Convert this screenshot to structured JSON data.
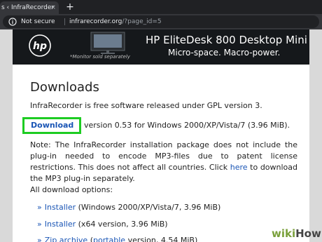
{
  "browser": {
    "tab_title": "s ‹ InfraRecorder",
    "tab_close": "×",
    "new_tab": "+",
    "not_secure": "Not secure",
    "url_domain": "infrarecorder.org",
    "url_path": "/?page_id=5"
  },
  "ad": {
    "title": "HP EliteDesk 800 Desktop Mini PC",
    "subtitle": "Micro-space. Macro-power.",
    "note": "*Monitor sold separately",
    "brand_color": "#15181b"
  },
  "page": {
    "heading": "Downloads",
    "intro": "InfraRecorder is free software released under GPL version 3.",
    "download_link": "Download",
    "download_rest": "version 0.53 for Windows 2000/XP/Vista/7 (3.96 MiB).",
    "note_part1": "Note: The InfraRecorder installation package does not include the plug-in needed to encode MP3-files due to patent license restrictions. This does not affect all countries. Click",
    "note_link": "here",
    "note_part2": "to download the MP3 plug-in separately.",
    "all_options": "All download options:",
    "options": [
      {
        "mark": "»",
        "link": "Installer",
        "rest": "(Windows 2000/XP/Vista/7, 3.96 MiB)"
      },
      {
        "mark": "»",
        "link": "Installer",
        "rest": "(x64 version, 3.96 MiB)"
      },
      {
        "mark": "»",
        "link": "Zip archive",
        "rest_open": "(",
        "link2": "portable",
        "rest": "version, 4.54 MiB)"
      }
    ],
    "highlight_color": "#1dcc22",
    "link_color": "#1a55b5"
  },
  "watermark": {
    "wiki": "wiki",
    "how": "How"
  }
}
